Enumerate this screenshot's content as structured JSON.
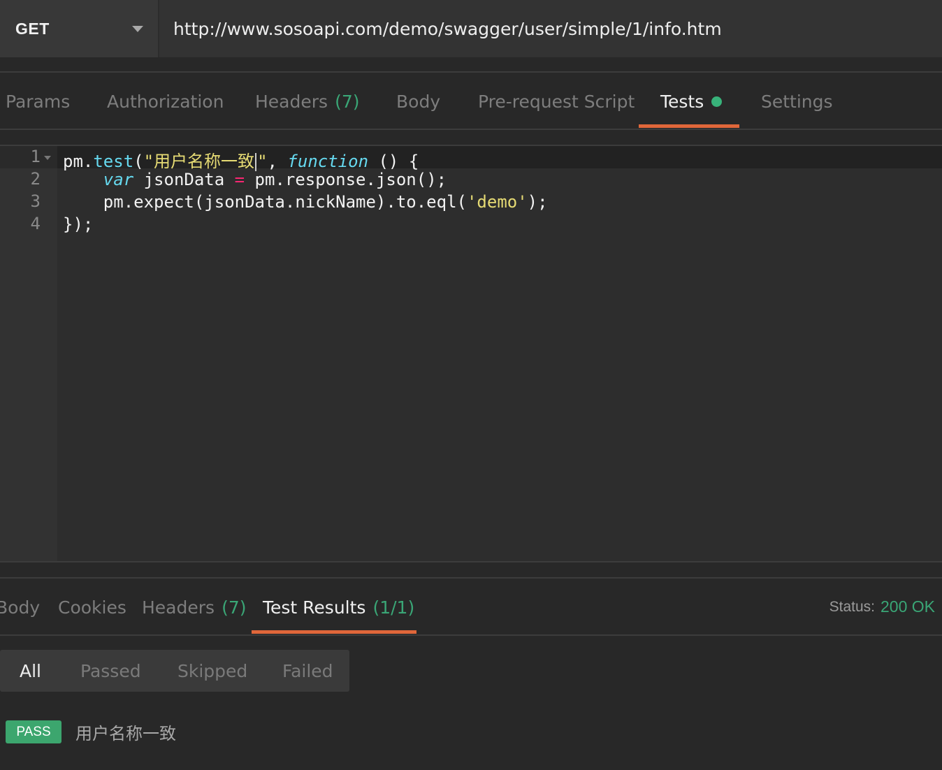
{
  "request": {
    "method": "GET",
    "url": "http://www.sosoapi.com/demo/swagger/user/simple/1/info.htm"
  },
  "request_tabs": {
    "params": "Params",
    "authorization": "Authorization",
    "headers": "Headers",
    "headers_count": "(7)",
    "body": "Body",
    "pre_request": "Pre-request Script",
    "tests": "Tests",
    "settings": "Settings"
  },
  "editor": {
    "line_numbers": [
      "1",
      "2",
      "3",
      "4"
    ],
    "line1": {
      "a": "pm.",
      "b": "test",
      "c": "(",
      "d": "\"用户名称一致",
      "e": "\"",
      "f": ", ",
      "g": "function",
      "h": " () {"
    },
    "line2": {
      "a": "    ",
      "b": "var",
      "c": " jsonData ",
      "d": "=",
      "e": " pm.response.json();"
    },
    "line3": {
      "a": "    pm.expect(jsonData.nickName).to.eql(",
      "b": "'demo'",
      "c": ");"
    },
    "line4": "});"
  },
  "response_tabs": {
    "body": "Body",
    "cookies": "Cookies",
    "headers": "Headers",
    "headers_count": "(7)",
    "test_results": "Test Results",
    "test_results_count": "(1/1)"
  },
  "status": {
    "label": "Status:",
    "value": "200 OK"
  },
  "filter": {
    "all": "All",
    "passed": "Passed",
    "skipped": "Skipped",
    "failed": "Failed"
  },
  "result": {
    "badge": "PASS",
    "name": "用户名称一致"
  },
  "colors": {
    "accent": "#e0673a",
    "success": "#3aa676",
    "background": "#282828"
  }
}
